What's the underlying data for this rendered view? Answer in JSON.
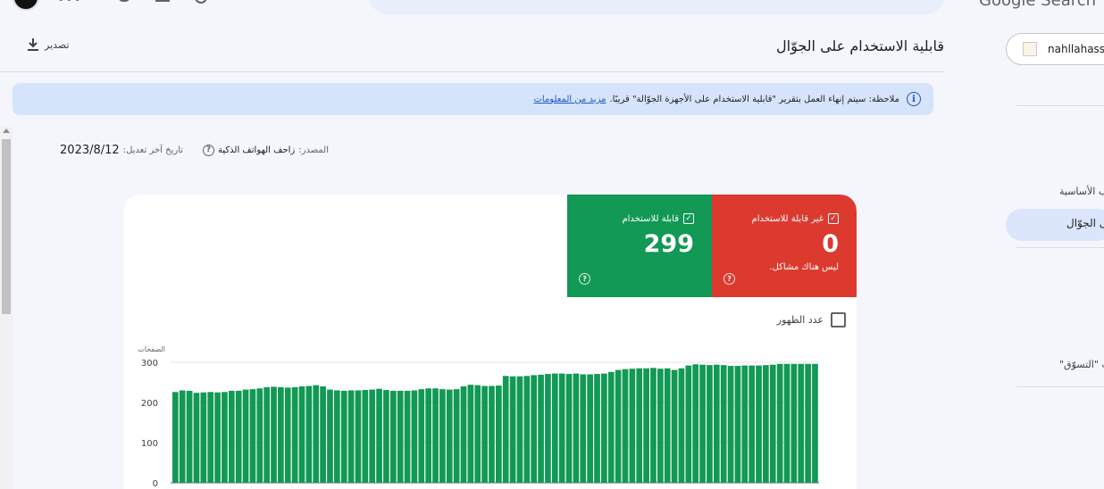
{
  "header": {
    "logo_text": "Google Search"
  },
  "property": {
    "name": "nahllahass"
  },
  "page": {
    "title": "قابلية الاستخدام على الجوّال",
    "export_label": "تصدير"
  },
  "notice": {
    "text": "ملاحظة: سيتم إنهاء العمل بتقرير \"قابلية الاستخدام على الأجهزة الجوّالة\" قريبًا.",
    "link": "مزيد من المعلومات"
  },
  "meta": {
    "source_label": "المصدر:",
    "source_value": "زاحف الهواتف الذكية",
    "updated_label": "تاريخ آخر تعديل:",
    "updated_value": "2023/8/12"
  },
  "sidebar": {
    "items": [
      {
        "label": "ب الأساسية"
      },
      {
        "label": "لى الجوّال"
      },
      {
        "label": "ريب \"التسوّق\""
      }
    ]
  },
  "tiles": {
    "not_usable": {
      "label": "غير قابلة للاستخدام",
      "value": "0",
      "subtext": "ليس هناك مشاكل.",
      "color": "#dc3a2f"
    },
    "usable": {
      "label": "قابلة للاستخدام",
      "value": "299",
      "color": "#129955"
    }
  },
  "impressions_toggle": {
    "label": "عدد الظهور",
    "checked": false
  },
  "chart_data": {
    "type": "bar",
    "ylabel": "الصفحات",
    "ylim": [
      0,
      300
    ],
    "yticks": [
      0,
      100,
      200,
      300
    ],
    "bar_color": "#129955",
    "values": [
      226,
      230,
      229,
      224,
      225,
      226,
      225,
      226,
      229,
      229,
      232,
      233,
      235,
      238,
      239,
      238,
      237,
      238,
      240,
      241,
      243,
      240,
      232,
      230,
      229,
      230,
      230,
      231,
      232,
      234,
      231,
      229,
      229,
      229,
      230,
      233,
      235,
      235,
      233,
      232,
      233,
      240,
      244,
      243,
      241,
      241,
      242,
      266,
      265,
      265,
      266,
      268,
      269,
      271,
      272,
      272,
      271,
      272,
      270,
      270,
      271,
      272,
      276,
      281,
      283,
      284,
      285,
      285,
      286,
      284,
      285,
      281,
      285,
      292,
      295,
      294,
      293,
      294,
      293,
      291,
      291,
      292,
      292,
      292,
      293,
      294,
      296,
      296,
      296,
      296,
      296,
      296
    ]
  }
}
